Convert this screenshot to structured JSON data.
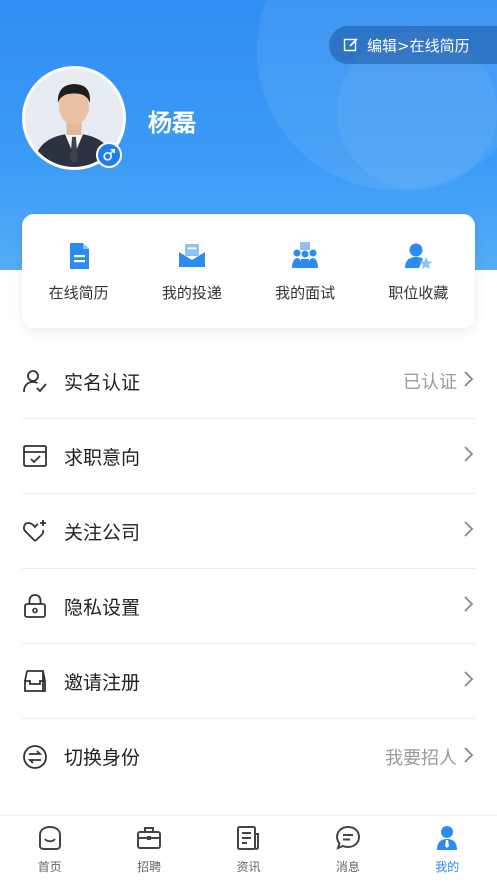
{
  "header": {
    "edit_label": "编辑>在线简历",
    "user_name": "杨磊"
  },
  "quick_actions": [
    {
      "label": "在线简历",
      "icon": "resume-icon"
    },
    {
      "label": "我的投递",
      "icon": "envelope-icon"
    },
    {
      "label": "我的面试",
      "icon": "interview-icon"
    },
    {
      "label": "职位收藏",
      "icon": "favorite-user-icon"
    }
  ],
  "menu": [
    {
      "label": "实名认证",
      "value": "已认证",
      "icon": "user-check-icon"
    },
    {
      "label": "求职意向",
      "value": "",
      "icon": "calendar-check-icon"
    },
    {
      "label": "关注公司",
      "value": "",
      "icon": "heart-plus-icon"
    },
    {
      "label": "隐私设置",
      "value": "",
      "icon": "lock-icon"
    },
    {
      "label": "邀请注册",
      "value": "",
      "icon": "inbox-icon"
    },
    {
      "label": "切换身份",
      "value": "我要招人",
      "icon": "swap-icon"
    }
  ],
  "tabbar": [
    {
      "label": "首页",
      "icon": "home-icon",
      "active": false
    },
    {
      "label": "招聘",
      "icon": "briefcase-icon",
      "active": false
    },
    {
      "label": "资讯",
      "icon": "news-icon",
      "active": false
    },
    {
      "label": "消息",
      "icon": "chat-icon",
      "active": false
    },
    {
      "label": "我的",
      "icon": "profile-icon",
      "active": true
    }
  ],
  "colors": {
    "primary": "#2a8bf2",
    "header_gradient_top": "#2f8ef3",
    "text": "#222222",
    "muted": "#9a9a9a"
  }
}
